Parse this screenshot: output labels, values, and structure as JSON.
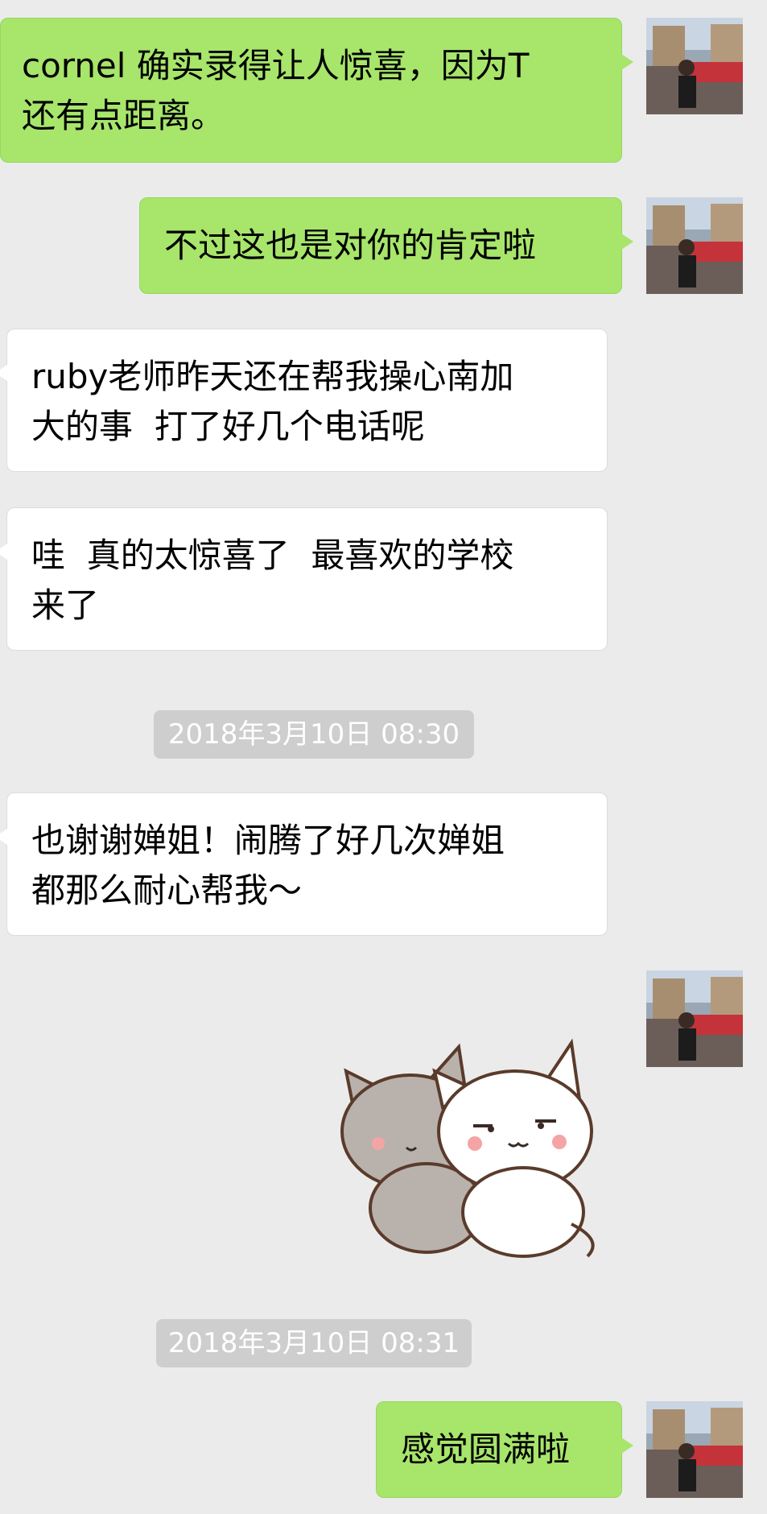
{
  "messages": [
    {
      "text": "cornel 确实录得让人惊喜，因为T\n还有点距离。",
      "side": "sent"
    },
    {
      "text": "不过这也是对你的肯定啦",
      "side": "sent"
    },
    {
      "text": "ruby老师昨天还在帮我操心南加\n大的事  打了好几个电话呢",
      "side": "received"
    },
    {
      "text": "哇  真的太惊喜了  最喜欢的学校\n来了",
      "side": "received"
    },
    {
      "text": "也谢谢婵姐！闹腾了好几次婵姐\n都那么耐心帮我～",
      "side": "received"
    },
    {
      "text": "感觉圆满啦",
      "side": "sent"
    }
  ],
  "timestamps": [
    "2018年3月10日 08:30",
    "2018年3月10日 08:31"
  ],
  "sticker": {
    "description": "sticker",
    "colors": {
      "gray_cat": "#b9b2ac",
      "white_cat": "#ffffff",
      "outline": "#5a3b2b",
      "blush": "#f4a4a4"
    }
  },
  "colors": {
    "sent_bubble": "#a7e56b",
    "received_bubble": "#ffffff",
    "background": "#ebebeb",
    "timestamp_bg": "#cecece"
  }
}
